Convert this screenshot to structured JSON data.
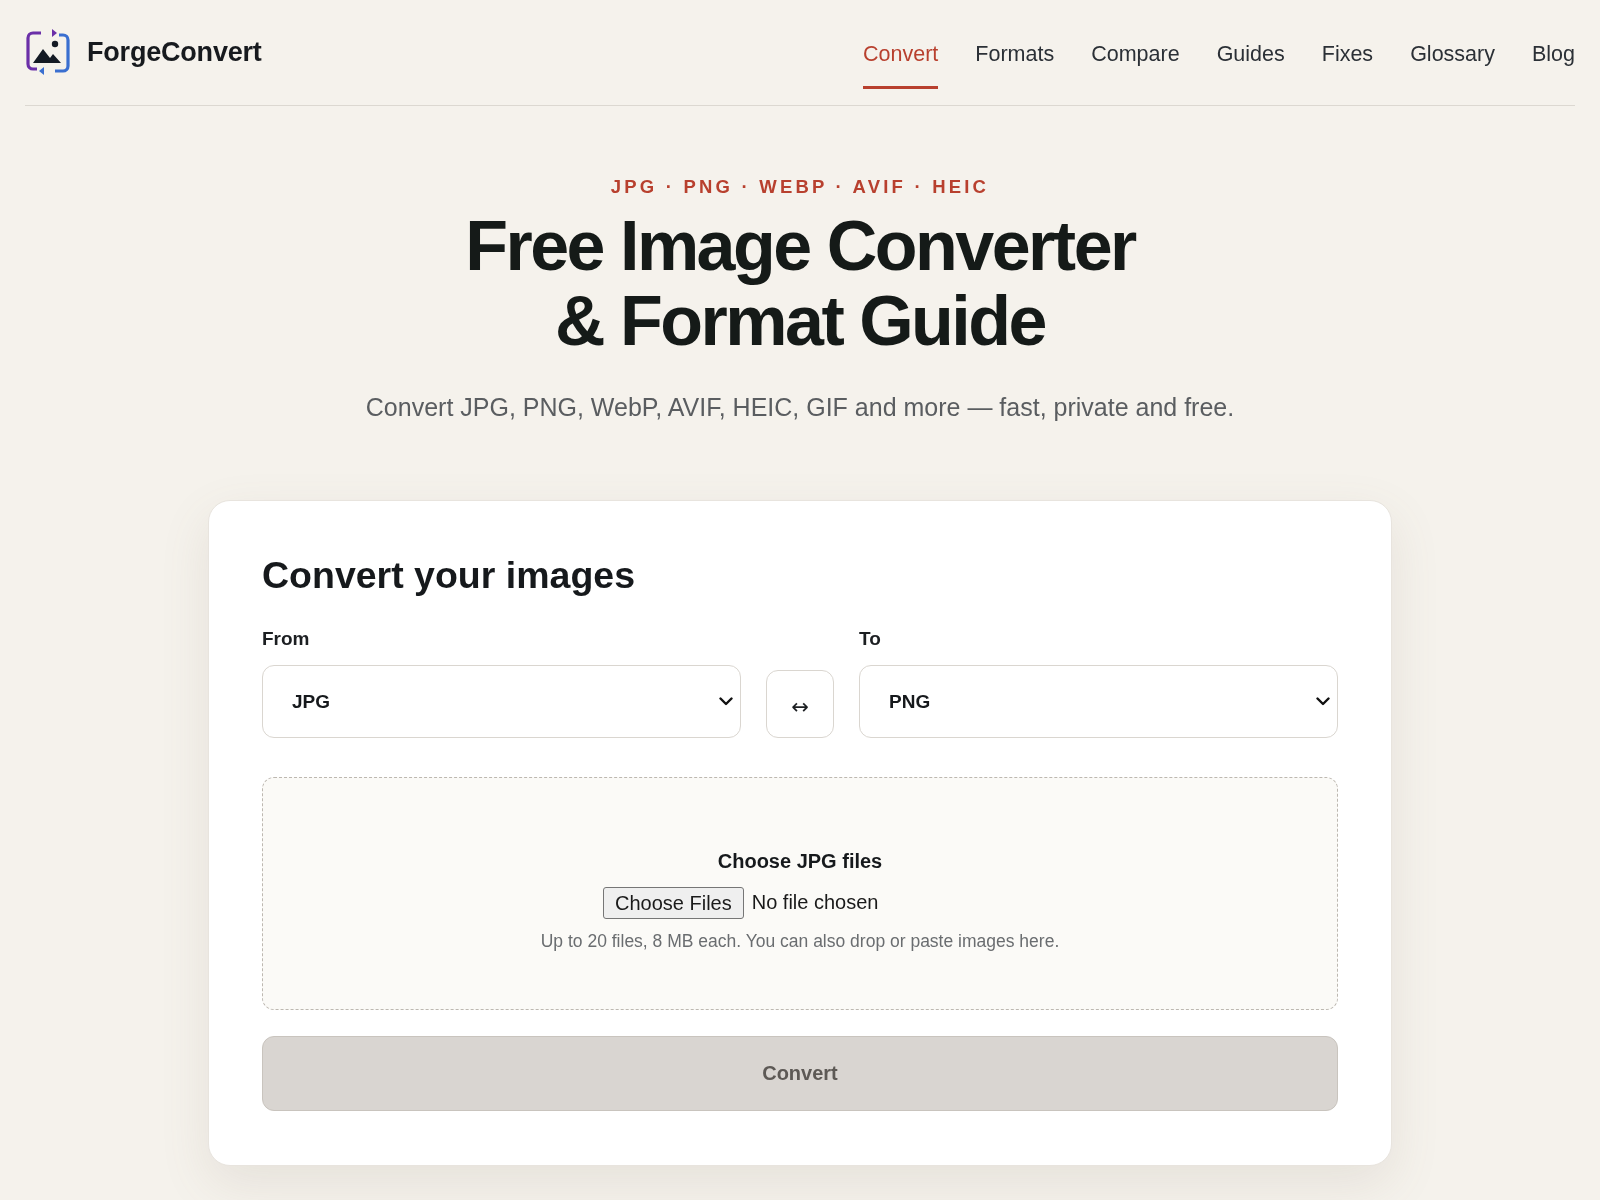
{
  "header": {
    "brand": "ForgeConvert",
    "nav": [
      {
        "label": "Convert",
        "selected": true
      },
      {
        "label": "Formats",
        "selected": false
      },
      {
        "label": "Compare",
        "selected": false
      },
      {
        "label": "Guides",
        "selected": false
      },
      {
        "label": "Fixes",
        "selected": false
      },
      {
        "label": "Glossary",
        "selected": false
      },
      {
        "label": "Blog",
        "selected": false
      }
    ]
  },
  "hero": {
    "eyebrow": "JPG · PNG · WEBP · AVIF · HEIC",
    "title_lines": [
      "Free Image Converter",
      "& Format Guide"
    ],
    "subtitle": "Convert JPG, PNG, WebP, AVIF, HEIC, GIF and more — fast, private and free."
  },
  "converter": {
    "title": "Convert your images",
    "from": {
      "label": "From",
      "value": "JPG"
    },
    "swap": "↔",
    "to": {
      "label": "To",
      "value": "PNG"
    },
    "dropzone": {
      "prompt": "Choose JPG files",
      "file_button": "Choose Files",
      "file_status": "No file chosen",
      "hint": "Up to 20 files, 8 MB each. You can also drop or paste images here."
    },
    "convert_button": {
      "label": "Convert",
      "disabled": true
    }
  }
}
